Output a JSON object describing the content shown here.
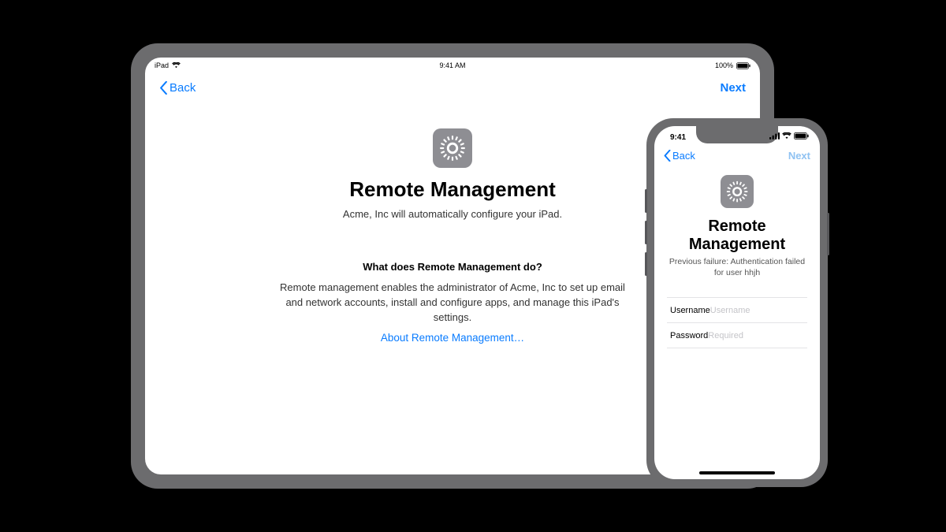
{
  "ipad": {
    "status": {
      "device": "iPad",
      "time": "9:41 AM",
      "battery": "100%"
    },
    "nav": {
      "back_label": "Back",
      "next_label": "Next"
    },
    "title": "Remote Management",
    "subtitle": "Acme, Inc will automatically configure your iPad.",
    "section_heading": "What does Remote Management do?",
    "section_body": "Remote management enables the administrator of Acme, Inc to set up email and network accounts, install and configure apps, and manage this iPad's settings.",
    "about_link": "About Remote Management…"
  },
  "iphone": {
    "status": {
      "time": "9:41"
    },
    "nav": {
      "back_label": "Back",
      "next_label": "Next"
    },
    "title": "Remote Management",
    "error_text": "Previous failure: Authentication failed for user hhjh",
    "fields": {
      "username": {
        "label": "Username",
        "placeholder": "Username"
      },
      "password": {
        "label": "Password",
        "placeholder": "Required"
      }
    }
  }
}
